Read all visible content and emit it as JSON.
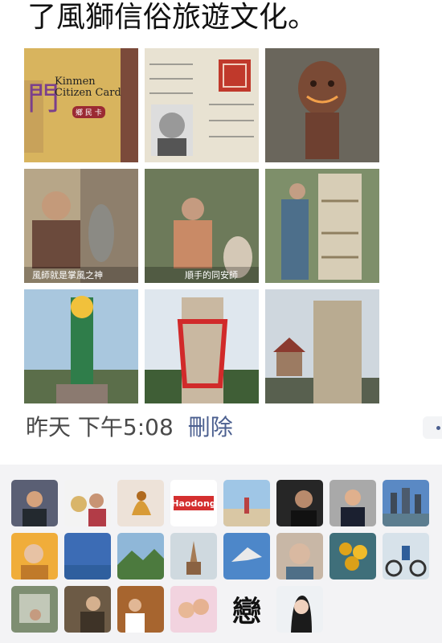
{
  "post": {
    "text": "了風獅信俗旅遊文化。"
  },
  "photos": [
    {
      "name": "kinmen-citizen-card",
      "caption_line1": "Kinmen",
      "caption_line2": "Citizen Card",
      "caption_cn": "門",
      "badge": "鄉 民 卡"
    },
    {
      "name": "id-document"
    },
    {
      "name": "wind-lion-carving"
    },
    {
      "name": "interview-man",
      "subtitle": "風師就是掌風之神"
    },
    {
      "name": "craftsman-painting",
      "subtitle": "順手的同安師"
    },
    {
      "name": "stone-lion-carving"
    },
    {
      "name": "painted-wind-lion"
    },
    {
      "name": "red-sash-lion"
    },
    {
      "name": "stone-lion-statue"
    }
  ],
  "meta": {
    "time": "昨天 下午5:08",
    "delete_label": "刪除"
  },
  "likes": {
    "avatars": [
      {
        "name": "avatar-1"
      },
      {
        "name": "avatar-2"
      },
      {
        "name": "avatar-3"
      },
      {
        "name": "avatar-4",
        "text": "Haodong"
      },
      {
        "name": "avatar-5"
      },
      {
        "name": "avatar-6"
      },
      {
        "name": "avatar-7"
      },
      {
        "name": "avatar-8"
      },
      {
        "name": "avatar-9"
      },
      {
        "name": "avatar-10"
      },
      {
        "name": "avatar-11"
      },
      {
        "name": "avatar-12"
      },
      {
        "name": "avatar-13"
      },
      {
        "name": "avatar-14"
      },
      {
        "name": "avatar-15"
      },
      {
        "name": "avatar-16"
      },
      {
        "name": "avatar-17"
      },
      {
        "name": "avatar-18"
      },
      {
        "name": "avatar-19"
      },
      {
        "name": "avatar-20"
      },
      {
        "name": "avatar-21",
        "text": "戀"
      },
      {
        "name": "avatar-22"
      }
    ]
  },
  "colors": {
    "link": "#4b5f8f",
    "likes_background": "#f3f3f5"
  }
}
